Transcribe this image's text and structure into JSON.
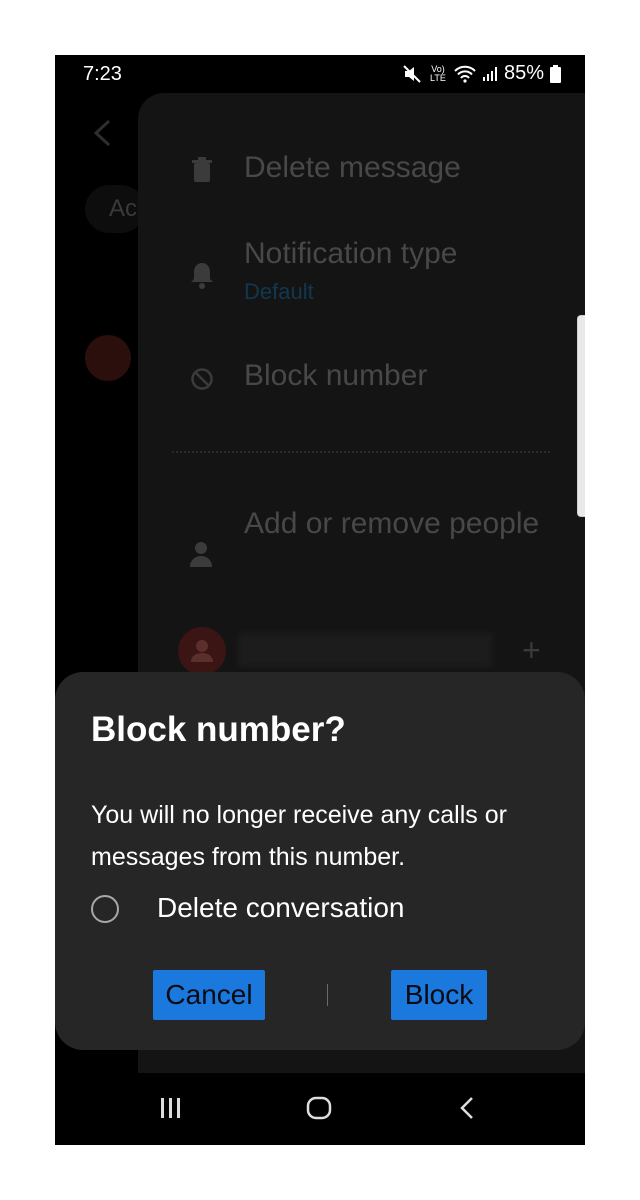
{
  "status_bar": {
    "time": "7:23",
    "network_label": "Vo) LTE",
    "battery": "85%",
    "icons": [
      "mute-icon",
      "volte-icon",
      "wifi-icon",
      "signal-icon",
      "battery-icon"
    ]
  },
  "background_screen": {
    "chip_text": "Ac"
  },
  "menu": {
    "items": [
      {
        "label": "Delete message",
        "icon": "trash-icon"
      },
      {
        "label": "Notification type",
        "sublabel": "Default",
        "icon": "bell-icon"
      },
      {
        "label": "Block number",
        "icon": "block-icon"
      },
      {
        "label": "Add or remove people",
        "icon": "person-icon"
      }
    ],
    "contact_add": "+"
  },
  "dialog": {
    "title": "Block number?",
    "message": "You will no longer receive any calls or messages from this number.",
    "checkbox_label": "Delete conversation",
    "cancel_label": "Cancel",
    "confirm_label": "Block"
  },
  "colors": {
    "dialog_bg": "#262626",
    "button_bg": "#1b78dc",
    "accent_dim": "#12384f"
  },
  "navbar": {
    "icons": [
      "recents-icon",
      "home-icon",
      "back-icon"
    ]
  }
}
